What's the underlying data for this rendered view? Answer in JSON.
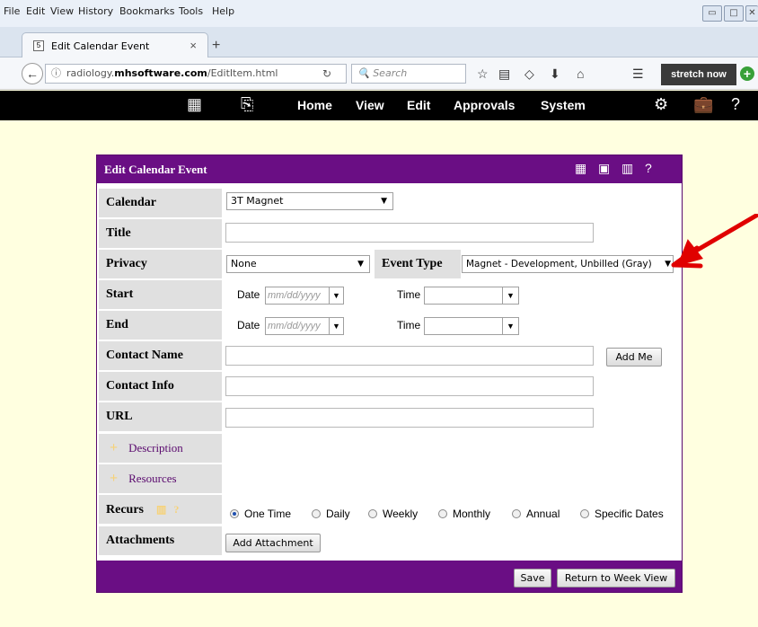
{
  "browser": {
    "menu": [
      "File",
      "Edit",
      "View",
      "History",
      "Bookmarks",
      "Tools",
      "Help"
    ],
    "tab_title": "Edit Calendar Event",
    "url_host_prefix": "radiology.",
    "url_host_bold": "mhsoftware.com",
    "url_path": "/EditItem.html",
    "search_placeholder": "Search",
    "extension_label": "stretch now"
  },
  "appnav": {
    "items": [
      "Home",
      "View",
      "Edit",
      "Approvals",
      "System"
    ]
  },
  "dialog": {
    "title": "Edit Calendar Event",
    "labels": {
      "calendar": "Calendar",
      "title": "Title",
      "privacy": "Privacy",
      "event_type": "Event Type",
      "start": "Start",
      "end": "End",
      "contact_name": "Contact Name",
      "contact_info": "Contact Info",
      "url": "URL",
      "description": "Description",
      "resources": "Resources",
      "recurs": "Recurs",
      "attachments": "Attachments"
    },
    "calendar_value": "3T Magnet",
    "privacy_value": "None",
    "event_type_value": "Magnet - Development, Unbilled (Gray)",
    "date_label": "Date",
    "date_placeholder": "mm/dd/yyyy",
    "time_label": "Time",
    "add_me": "Add Me",
    "recurrence": [
      {
        "label": "One Time",
        "selected": true
      },
      {
        "label": "Daily",
        "selected": false
      },
      {
        "label": "Weekly",
        "selected": false
      },
      {
        "label": "Monthly",
        "selected": false
      },
      {
        "label": "Annual",
        "selected": false
      },
      {
        "label": "Specific Dates",
        "selected": false
      }
    ],
    "add_attachment": "Add Attachment",
    "save": "Save",
    "return": "Return to Week View"
  },
  "colors": {
    "header_purple": "#6a0e84",
    "page_bg": "#ffffe0",
    "arrow_red": "#e00000"
  }
}
